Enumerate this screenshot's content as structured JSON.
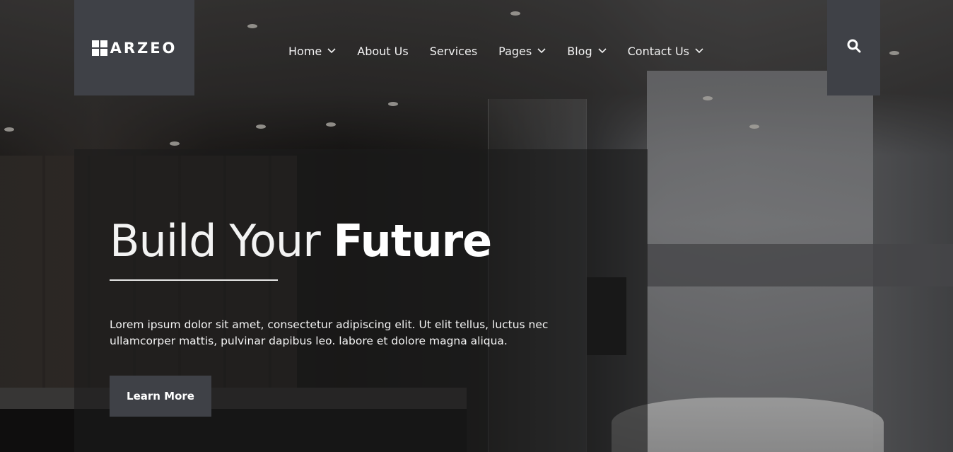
{
  "brand": {
    "logo_text": "ARZEO"
  },
  "nav": {
    "items": [
      {
        "label": "Home",
        "has_dropdown": true
      },
      {
        "label": "About Us",
        "has_dropdown": false
      },
      {
        "label": "Services",
        "has_dropdown": false
      },
      {
        "label": "Pages",
        "has_dropdown": true
      },
      {
        "label": "Blog",
        "has_dropdown": true
      },
      {
        "label": "Contact Us",
        "has_dropdown": true
      }
    ],
    "search_icon": "search-icon"
  },
  "hero": {
    "title_light": "Build Your ",
    "title_bold": "Future",
    "description": "Lorem ipsum dolor sit amet, consectetur adipiscing elit. Ut elit tellus, luctus nec ullamcorper mattis, pulvinar dapibus leo. labore et dolore magna aliqua.",
    "cta_label": "Learn More"
  },
  "colors": {
    "accent_box": "#3f4147",
    "text": "#ffffff"
  }
}
